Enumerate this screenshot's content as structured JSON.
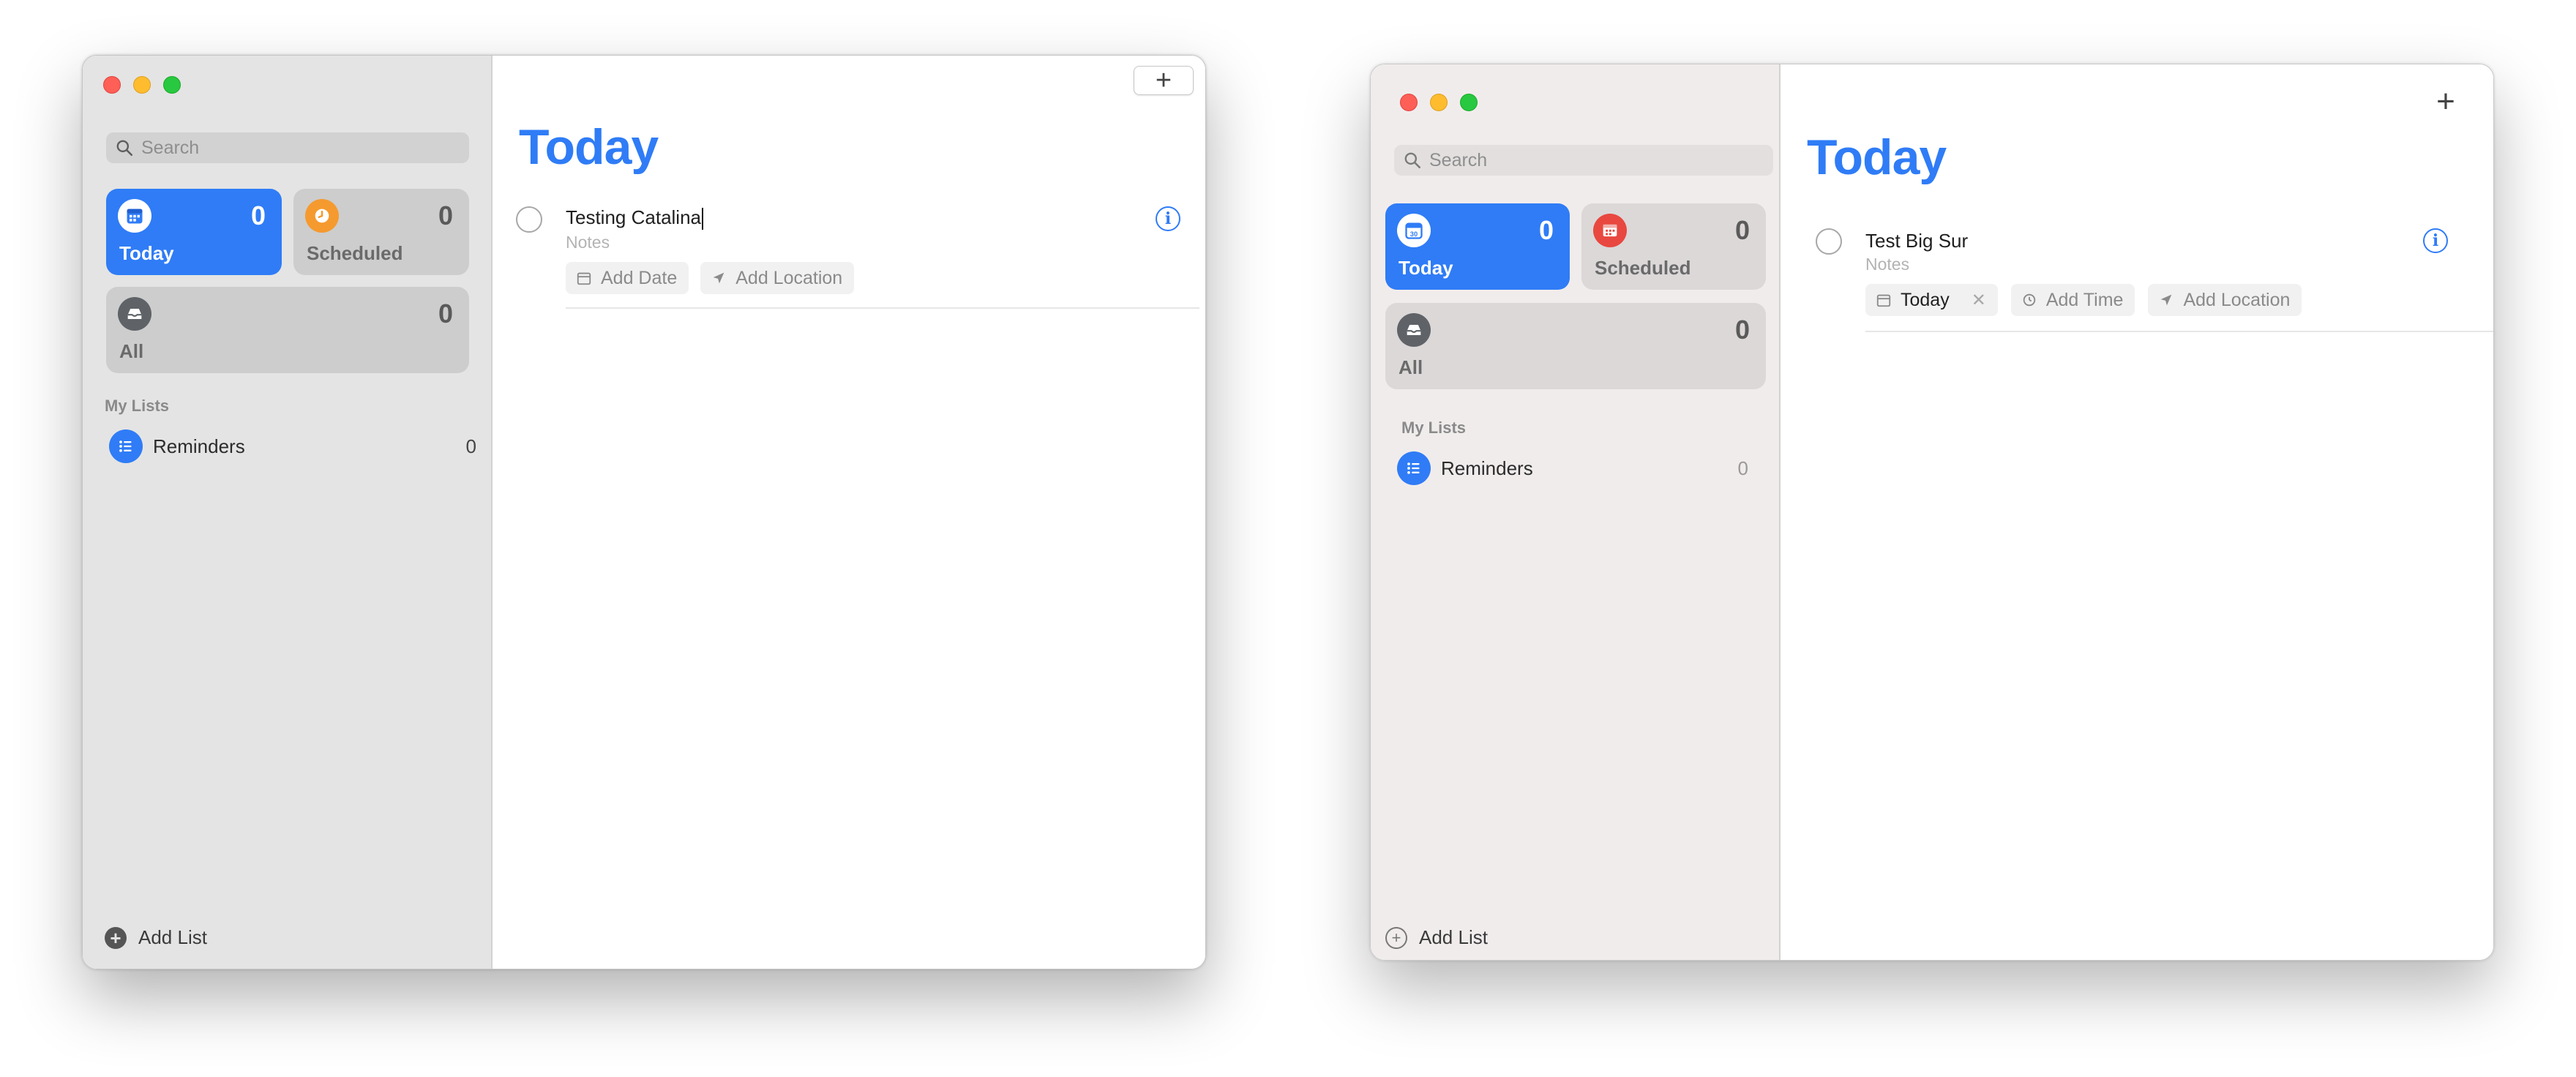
{
  "windows": {
    "left": {
      "search": {
        "placeholder": "Search"
      },
      "cards": {
        "today": {
          "label": "Today",
          "count": "0",
          "icon": "calendar-icon"
        },
        "scheduled": {
          "label": "Scheduled",
          "count": "0",
          "icon": "clock-icon"
        },
        "all": {
          "label": "All",
          "count": "0",
          "icon": "tray-icon"
        }
      },
      "section_label": "My Lists",
      "lists": [
        {
          "name": "Reminders",
          "count": "0",
          "icon": "list-bullet-icon"
        }
      ],
      "add_list_label": "Add List",
      "add_button": "+",
      "title": "Today",
      "reminder": {
        "title": "Testing Catalina",
        "notes": "Notes",
        "chips": {
          "date": "Add Date",
          "location": "Add Location"
        }
      },
      "colors": {
        "accent": "#2f7cf6",
        "scheduled": "#f59a2e",
        "all": "#5f6368"
      }
    },
    "right": {
      "search": {
        "placeholder": "Search"
      },
      "cards": {
        "today": {
          "label": "Today",
          "count": "0",
          "icon": "calendar-icon",
          "icon_day": "30"
        },
        "scheduled": {
          "label": "Scheduled",
          "count": "0",
          "icon": "calendar-icon"
        },
        "all": {
          "label": "All",
          "count": "0",
          "icon": "tray-icon"
        }
      },
      "section_label": "My Lists",
      "lists": [
        {
          "name": "Reminders",
          "count": "0",
          "icon": "list-bullet-icon"
        }
      ],
      "add_list_label": "Add List",
      "add_button": "+",
      "title": "Today",
      "reminder": {
        "title": "Test Big Sur",
        "notes": "Notes",
        "chips": {
          "date": "Today",
          "date_clear": "✕",
          "time": "Add Time",
          "location": "Add Location"
        }
      },
      "colors": {
        "accent": "#2f7cf6",
        "scheduled": "#e8483f",
        "all": "#5f6368"
      }
    }
  }
}
